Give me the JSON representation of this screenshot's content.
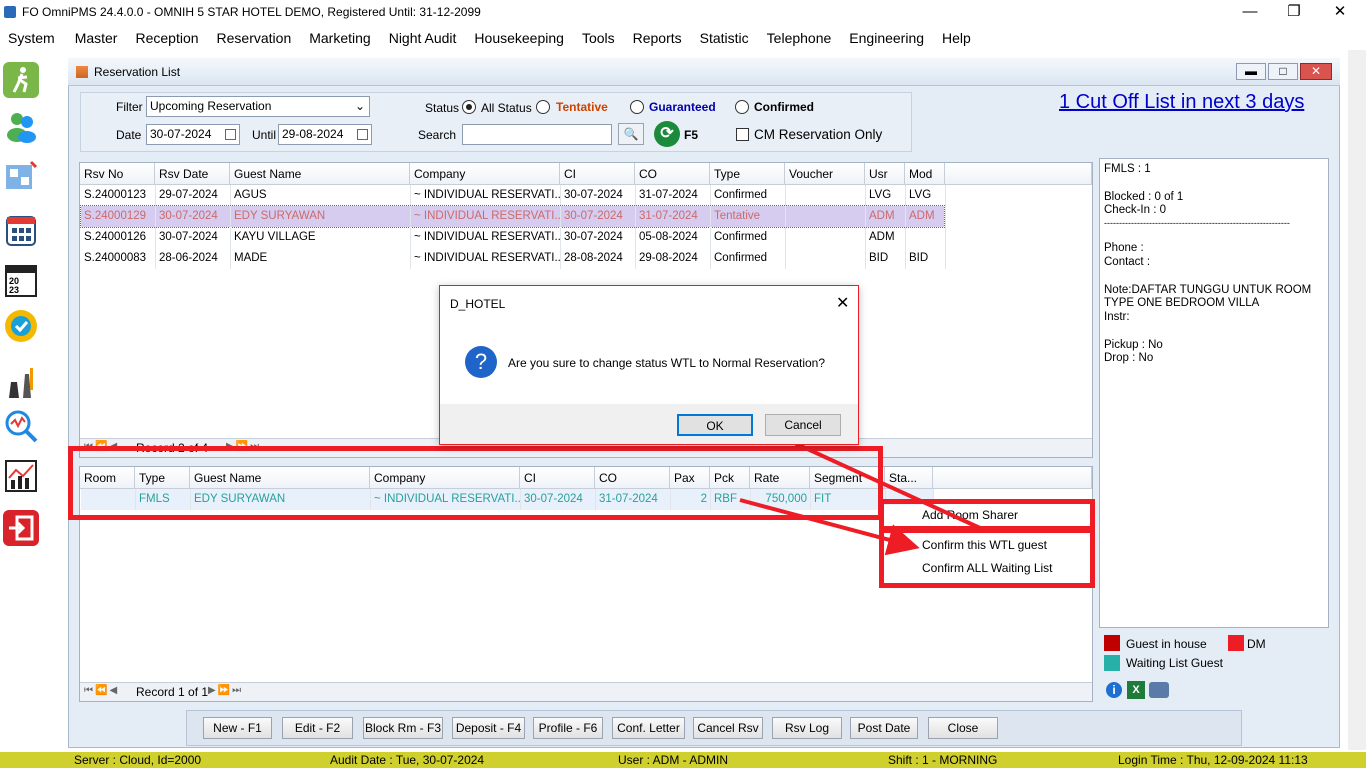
{
  "window": {
    "title": "FO OmniPMS 24.4.0.0 - OMNIH 5 STAR HOTEL DEMO, Registered Until: 31-12-2099"
  },
  "menu": [
    "System",
    "Master",
    "Reception",
    "Reservation",
    "Marketing",
    "Night Audit",
    "Housekeeping",
    "Tools",
    "Reports",
    "Statistic",
    "Telephone",
    "Engineering",
    "Help"
  ],
  "sidebar_icons": [
    "walk-in-icon",
    "guests-icon",
    "floor-plan-icon",
    "calendar-grid-icon",
    "calendar-2023-icon",
    "guarantee-badge-icon",
    "housekeeping-icon",
    "analytics-icon",
    "statistics-chart-icon",
    "exit-icon"
  ],
  "child": {
    "title": "Reservation List"
  },
  "filter": {
    "filter_label": "Filter",
    "filter_value": "Upcoming Reservation",
    "date_label": "Date",
    "date_value": "30-07-2024",
    "until_label": "Until",
    "until_value": "29-08-2024",
    "status_label": "Status",
    "status_options": [
      "All Status",
      "Tentative",
      "Guaranteed",
      "Confirmed"
    ],
    "status_selected": "All Status",
    "search_label": "Search",
    "search_value": "",
    "refresh_key": "F5",
    "cm_only_label": "CM Reservation Only"
  },
  "cutoff_link": "1 Cut Off List in next 3 days",
  "reservations": {
    "columns": [
      "Rsv No",
      "Rsv Date",
      "Guest Name",
      "Company",
      "CI",
      "CO",
      "Type",
      "Voucher",
      "Usr",
      "Mod"
    ],
    "rows": [
      [
        "S.24000123",
        "29-07-2024",
        "AGUS",
        "~ INDIVIDUAL RESERVATI...",
        "30-07-2024",
        "31-07-2024",
        "Confirmed",
        "",
        "LVG",
        "LVG"
      ],
      [
        "S.24000129",
        "30-07-2024",
        "EDY SURYAWAN",
        "~ INDIVIDUAL RESERVATI...",
        "30-07-2024",
        "31-07-2024",
        "Tentative",
        "",
        "ADM",
        "ADM"
      ],
      [
        "S.24000126",
        "30-07-2024",
        "KAYU VILLAGE",
        "~ INDIVIDUAL RESERVATI...",
        "30-07-2024",
        "05-08-2024",
        "Confirmed",
        "",
        "ADM",
        ""
      ],
      [
        "S.24000083",
        "28-06-2024",
        "MADE",
        "~ INDIVIDUAL RESERVATI...",
        "28-08-2024",
        "29-08-2024",
        "Confirmed",
        "",
        "BID",
        "BID"
      ]
    ],
    "nav_record": "Record 2 of 4"
  },
  "rooms": {
    "columns": [
      "Room",
      "Type",
      "Guest Name",
      "Company",
      "CI",
      "CO",
      "Pax",
      "Pck",
      "Rate",
      "Segment",
      "Sta..."
    ],
    "rows": [
      [
        "",
        "FMLS",
        "EDY SURYAWAN",
        "~ INDIVIDUAL RESERVATI...",
        "30-07-2024",
        "31-07-2024",
        "2",
        "RBF",
        "750,000",
        "FIT",
        ""
      ]
    ],
    "nav_record": "Record 1 of 1"
  },
  "info_panel": {
    "lines": [
      "FMLS : 1",
      "",
      "Blocked : 0 of 1",
      "Check-In : 0",
      "--------------------------------------------------------------",
      "",
      "Phone :",
      "Contact :",
      "",
      "Note:DAFTAR TUNGGU UNTUK ROOM",
      "TYPE ONE BEDROOM VILLA",
      "Instr:",
      "",
      "Pickup : No",
      "Drop : No"
    ]
  },
  "legend": [
    {
      "label": "Guest in house",
      "color": "#c00000"
    },
    {
      "label": "DM",
      "color": "#ee1c25"
    },
    {
      "label": "Waiting List Guest",
      "color": "#27b0a8"
    }
  ],
  "context_menu": [
    "Add Room Sharer",
    "Confirm this WTL guest",
    "Confirm ALL Waiting List"
  ],
  "dialog": {
    "title": "D_HOTEL",
    "message": "Are you sure to change status WTL to Normal Reservation?",
    "ok": "OK",
    "cancel": "Cancel"
  },
  "buttons": [
    "New - F1",
    "Edit - F2",
    "Block Rm - F3",
    "Deposit - F4",
    "Profile  - F6",
    "Conf. Letter",
    "Cancel Rsv",
    "Rsv Log",
    "Post Date",
    "Close"
  ],
  "status_bar": {
    "server": "Server : Cloud, Id=2000",
    "audit": "Audit Date : Tue, 30-07-2024",
    "user": "User : ADM - ADMIN",
    "shift": "Shift : 1 - MORNING",
    "login": "Login Time : Thu, 12-09-2024 11:13"
  },
  "colors": {
    "accent_link": "#0000cc",
    "tentative": "#cc4400",
    "guaranteed": "#0000aa",
    "highlight_box": "#ee1c25",
    "status_bar": "#cfcf2e"
  }
}
